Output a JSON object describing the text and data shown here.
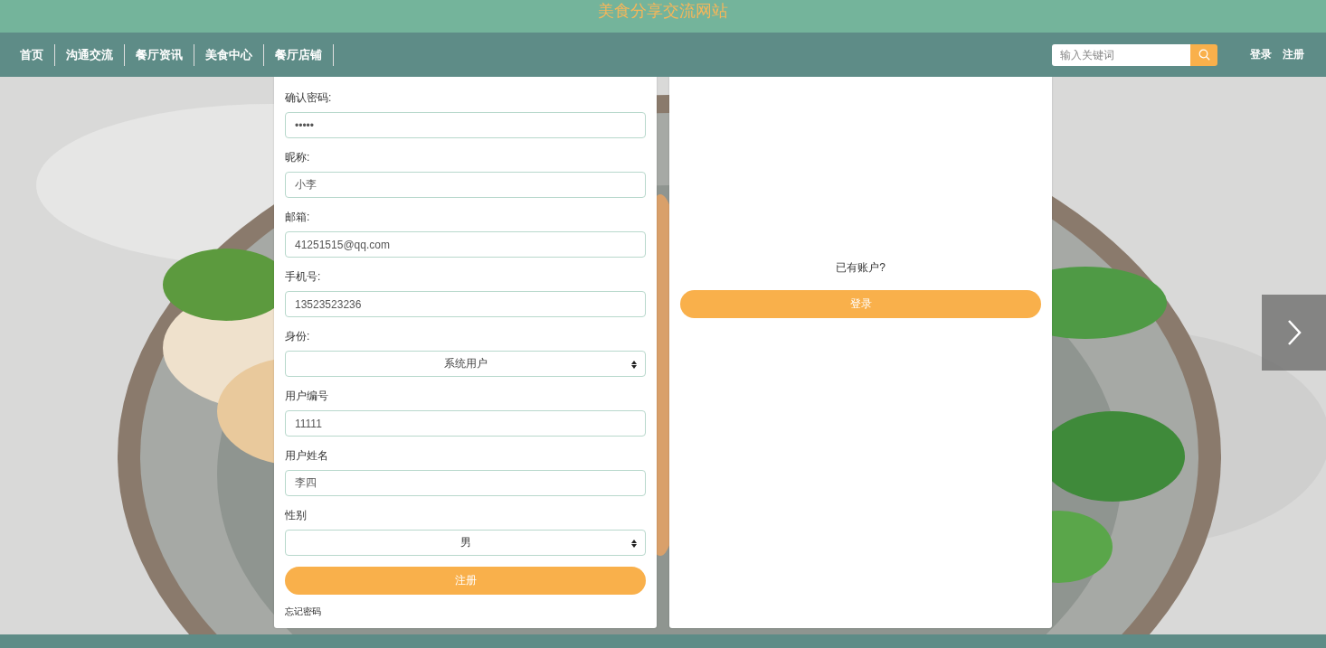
{
  "header": {
    "title": "美食分享交流网站"
  },
  "nav": {
    "items": [
      {
        "label": "首页"
      },
      {
        "label": "沟通交流"
      },
      {
        "label": "餐厅资讯"
      },
      {
        "label": "美食中心"
      },
      {
        "label": "餐厅店铺"
      }
    ],
    "search": {
      "placeholder": "输入关键词"
    },
    "links": [
      {
        "label": "登录"
      },
      {
        "label": "注册"
      }
    ]
  },
  "register_form": {
    "fields": [
      {
        "kind": "input",
        "label": "确认密码:",
        "value": "•••••"
      },
      {
        "kind": "input",
        "label": "昵称:",
        "value": "小李"
      },
      {
        "kind": "input",
        "label": "邮箱:",
        "value": "41251515@qq.com"
      },
      {
        "kind": "input",
        "label": "手机号:",
        "value": "13523523236"
      },
      {
        "kind": "select",
        "label": "身份:",
        "value": "系统用户"
      },
      {
        "kind": "input",
        "label": "用户编号",
        "value": "11111"
      },
      {
        "kind": "input",
        "label": "用户姓名",
        "value": "李四"
      },
      {
        "kind": "select",
        "label": "性别",
        "value": "男"
      }
    ],
    "submit": "注册",
    "forgot": "忘记密码"
  },
  "login_panel": {
    "prompt": "已有账户?",
    "button": "登录"
  }
}
